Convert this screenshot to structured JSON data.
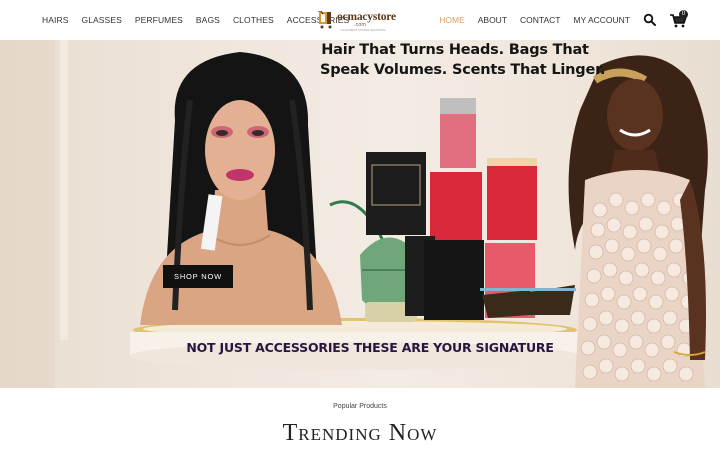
{
  "nav": {
    "left": [
      {
        "label": "HAIRS"
      },
      {
        "label": "GLASSES"
      },
      {
        "label": "PERFUMES"
      },
      {
        "label": "BAGS"
      },
      {
        "label": "CLOTHES"
      },
      {
        "label": "ACCESSORIES"
      }
    ],
    "right": [
      {
        "label": "HOME",
        "active": true
      },
      {
        "label": "ABOUT"
      },
      {
        "label": "CONTACT"
      },
      {
        "label": "MY ACCOUNT"
      }
    ],
    "cart_count": "0",
    "accent_color": "#d9a066"
  },
  "logo": {
    "text": "ocmacystore",
    "sub": ".com",
    "tagline": "YOUR BEST ONLINE SHOPPING"
  },
  "hero": {
    "headline_line1": "Hair That Turns Heads. Bags That",
    "headline_line2": "Speak Volumes. Scents That Linger.",
    "signature": "NOT JUST ACCESSORIES THESE ARE YOUR SIGNATURE",
    "shop_button": "SHOP NOW"
  },
  "section": {
    "kicker": "Popular Products",
    "title": "Trending Now"
  },
  "icons": {
    "search": "search-icon",
    "cart": "cart-icon"
  }
}
